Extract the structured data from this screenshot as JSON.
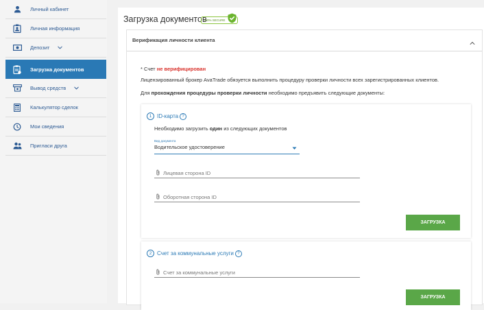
{
  "sidebar": {
    "items": [
      {
        "label": "Личный кабинет",
        "icon": "user-icon"
      },
      {
        "label": "Личная информация",
        "icon": "id-card-icon"
      },
      {
        "label": "Депозит",
        "icon": "money-icon"
      },
      {
        "label": "Загрузка документов",
        "icon": "document-upload-icon"
      },
      {
        "label": "Вывод средств",
        "icon": "withdraw-icon"
      },
      {
        "label": "Калькулятор сделок",
        "icon": "calculator-icon"
      },
      {
        "label": "Мои сведения",
        "icon": "history-icon"
      },
      {
        "label": "Пригласи друга",
        "icon": "invite-friends-icon"
      }
    ]
  },
  "main": {
    "title": "Загрузка документов",
    "secure_badge": "100% SECURE",
    "section_header": "Верификация личности клиента",
    "status_prefix": "* Счет",
    "status_value": "не верифицирован",
    "info_text": "Лицензированный брокер AvaTrade обязуется выполнить процедуру проверки личности всех зарегистрированных клиентов.",
    "info2_pre": "Для",
    "info2_bold": "прохождения процедуры проверки личности",
    "info2_post": "необходимо предъявить следующие документы:",
    "id_box": {
      "number": "1",
      "title": "ID-карта",
      "need_pre": "Необходимо загрузить",
      "need_bold": "один",
      "need_post": "из следующих документов",
      "doc_type_label": "Вид документа",
      "doc_type_value": "Водительское удостоверение",
      "front_placeholder": "Лицевая сторона ID",
      "back_placeholder": "Оборотная сторона ID",
      "upload_label": "ЗАГРУЗКА"
    },
    "utility_box": {
      "number": "2",
      "title": "Счет за коммунальные услуги",
      "placeholder": "Счет за коммунальные услуги",
      "upload_label": "ЗАГРУЗКА"
    }
  },
  "colors": {
    "accent": "#2a79b5",
    "active_nav": "#2a79b5",
    "upload_button": "#5aa748",
    "error": "#d9322c"
  }
}
